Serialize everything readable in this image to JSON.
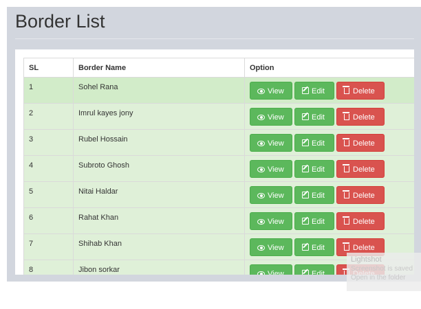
{
  "page": {
    "title": "Border List"
  },
  "table": {
    "headers": {
      "sl": "SL",
      "name": "Border Name",
      "option": "Option"
    },
    "buttons": {
      "view": "View",
      "edit": "Edit",
      "delete": "Delete"
    },
    "rows": [
      {
        "sl": "1",
        "name": "Sohel Rana"
      },
      {
        "sl": "2",
        "name": "Imrul kayes jony"
      },
      {
        "sl": "3",
        "name": "Rubel Hossain"
      },
      {
        "sl": "4",
        "name": "Subroto Ghosh"
      },
      {
        "sl": "5",
        "name": "Nitai Haldar"
      },
      {
        "sl": "6",
        "name": "Rahat Khan"
      },
      {
        "sl": "7",
        "name": "Shihab Khan"
      },
      {
        "sl": "8",
        "name": "Jibon sorkar"
      }
    ]
  },
  "toast": {
    "title": "Lightshot",
    "line1": "Screenshot is saved",
    "line2": "Open in the folder"
  },
  "colors": {
    "success": "#5cb85c",
    "danger": "#d9534f",
    "row_bg": "#dff0d8",
    "page_bg": "#d2d6de"
  },
  "icons": {
    "view": "eye-icon",
    "edit": "edit-icon",
    "delete": "trash-icon"
  }
}
